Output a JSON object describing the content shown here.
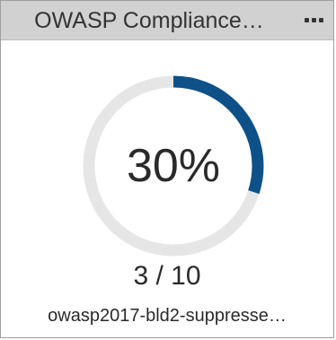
{
  "widget": {
    "title": "OWASP Compliance…",
    "menu_icon": "ellipsis-icon",
    "percent_label": "30%",
    "progress_fraction": 0.3,
    "count_label": "3 / 10",
    "subtitle": "owasp2017-bld2-suppresse…"
  },
  "colors": {
    "header_bg": "#d1d1d1",
    "track": "#e6e6e6",
    "progress": "#0e5188",
    "text": "#2a2a2a"
  }
}
